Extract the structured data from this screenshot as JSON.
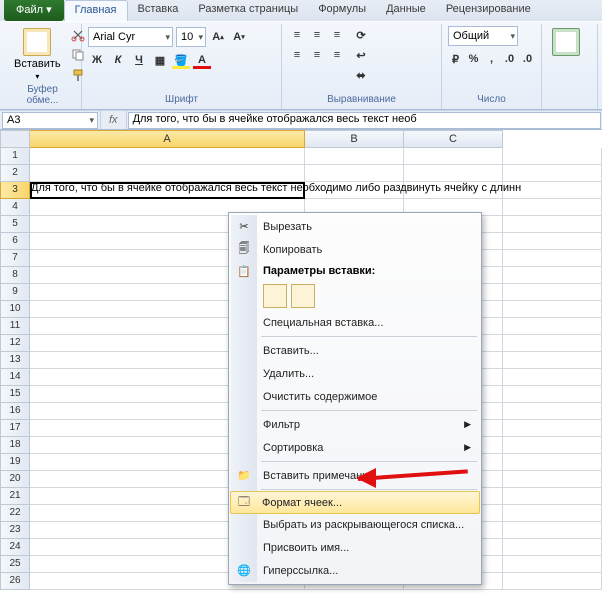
{
  "tabs": {
    "file": "Файл",
    "home": "Главная",
    "insert": "Вставка",
    "layout": "Разметка страницы",
    "formulas": "Формулы",
    "data": "Данные",
    "review": "Рецензирование"
  },
  "ribbon": {
    "paste_label": "Вставить",
    "clipboard_group": "Буфер обме...",
    "font_group": "Шрифт",
    "align_group": "Выравнивание",
    "number_group": "Число",
    "font_name": "Arial Cyr",
    "font_size": "10",
    "number_format": "Общий",
    "bold": "Ж",
    "italic": "К",
    "underline": "Ч"
  },
  "namebox": "A3",
  "fx_label": "fx",
  "formula_text": "Для того, что бы в ячейке отображался весь текст необ",
  "columns": [
    "A",
    "B",
    "C"
  ],
  "cell_overflow": "Для того, что бы в ячейке отображался весь текст необходимо либо раздвинуть ячейку с длинн",
  "rows": [
    1,
    2,
    3,
    4,
    5,
    6,
    7,
    8,
    9,
    10,
    11,
    12,
    13,
    14,
    15,
    16,
    17,
    18,
    19,
    20,
    21,
    22,
    23,
    24,
    25,
    26
  ],
  "context_menu": {
    "cut": "Вырезать",
    "copy": "Копировать",
    "paste_options": "Параметры вставки:",
    "paste_special": "Специальная вставка...",
    "insert": "Вставить...",
    "delete": "Удалить...",
    "clear": "Очистить содержимое",
    "filter": "Фильтр",
    "sort": "Сортировка",
    "comment": "Вставить примечание",
    "format_cells": "Формат ячеек...",
    "pick_list": "Выбрать из раскрывающегося списка...",
    "define_name": "Присвоить имя...",
    "hyperlink": "Гиперссылка..."
  }
}
